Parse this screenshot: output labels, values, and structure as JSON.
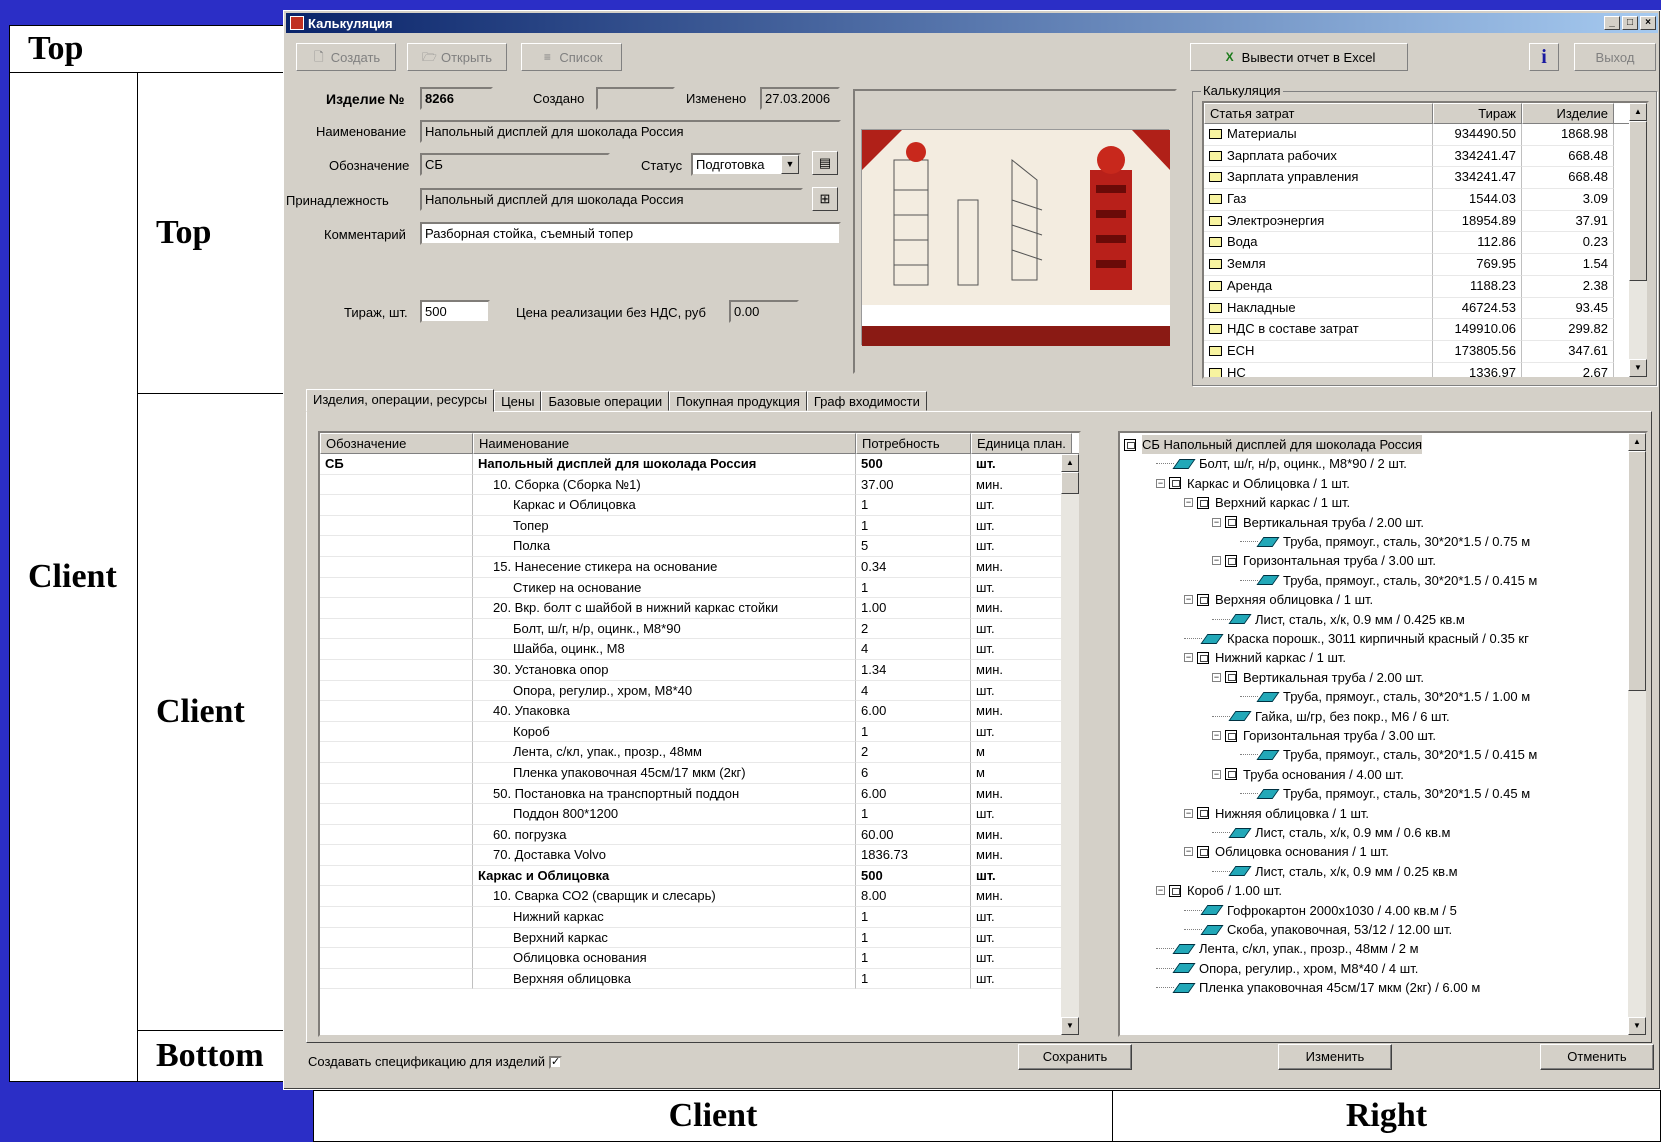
{
  "labels": {
    "top1": "Top",
    "client1": "Client",
    "top2": "Top",
    "client2": "Client",
    "bottom": "Bottom",
    "client3": "Client",
    "right": "Right"
  },
  "window": {
    "title": "Калькуляция"
  },
  "toolbar": {
    "create": "Создать",
    "open": "Открыть",
    "list": "Список",
    "excel": "Вывести отчет в Excel",
    "exit": "Выход",
    "info_icon": "info-icon"
  },
  "form": {
    "item_no_label": "Изделие №",
    "item_no": "8266",
    "created_label": "Создано",
    "created": "",
    "changed_label": "Изменено",
    "changed": "27.03.2006",
    "name_label": "Наименование",
    "name": "Напольный дисплей для шоколада Россия",
    "designation_label": "Обозначение",
    "designation": "СБ",
    "status_label": "Статус",
    "status": "Подготовка",
    "belongs_label": "Принадлежность",
    "belongs": "Напольный дисплей для шоколада Россия",
    "comment_label": "Комментарий",
    "comment": "Разборная стойка, съемный топер",
    "run_label": "Тираж, шт.",
    "run": "500",
    "price_label": "Цена реализации без НДС, руб",
    "price": "0.00"
  },
  "calc": {
    "title": "Калькуляция",
    "headers": [
      "Статья затрат",
      "Тираж",
      "Изделие"
    ],
    "rows": [
      [
        "Материалы",
        "934490.50",
        "1868.98"
      ],
      [
        "Зарплата рабочих",
        "334241.47",
        "668.48"
      ],
      [
        "Зарплата управления",
        "334241.47",
        "668.48"
      ],
      [
        "Газ",
        "1544.03",
        "3.09"
      ],
      [
        "Электроэнергия",
        "18954.89",
        "37.91"
      ],
      [
        "Вода",
        "112.86",
        "0.23"
      ],
      [
        "Земля",
        "769.95",
        "1.54"
      ],
      [
        "Аренда",
        "1188.23",
        "2.38"
      ],
      [
        "Накладные",
        "46724.53",
        "93.45"
      ],
      [
        "НДС в составе затрат",
        "149910.06",
        "299.82"
      ],
      [
        "ЕСН",
        "173805.56",
        "347.61"
      ],
      [
        "НС",
        "1336.97",
        "2.67"
      ]
    ]
  },
  "tabs": [
    "Изделия, операции, ресурсы",
    "Цены",
    "Базовые операции",
    "Покупная продукция",
    "Граф входимости"
  ],
  "ops": {
    "headers": [
      "Обозначение",
      "Наименование",
      "Потребность",
      "Единица план."
    ],
    "rows": [
      {
        "d": "СБ",
        "n": "Напольный дисплей для шоколада Россия",
        "q": "500",
        "u": "шт.",
        "lvl": 0,
        "b": true
      },
      {
        "d": "",
        "n": "10. Сборка (Сборка №1)",
        "q": "37.00",
        "u": "мин.",
        "lvl": 1
      },
      {
        "d": "",
        "n": "Каркас и Облицовка",
        "q": "1",
        "u": "шт.",
        "lvl": 2
      },
      {
        "d": "",
        "n": "Топер",
        "q": "1",
        "u": "шт.",
        "lvl": 2
      },
      {
        "d": "",
        "n": "Полка",
        "q": "5",
        "u": "шт.",
        "lvl": 2
      },
      {
        "d": "",
        "n": "15. Нанесение стикера на основание",
        "q": "0.34",
        "u": "мин.",
        "lvl": 1
      },
      {
        "d": "",
        "n": "Стикер на основание",
        "q": "1",
        "u": "шт.",
        "lvl": 2
      },
      {
        "d": "",
        "n": "20. Вкр. болт с шайбой в нижний каркас стойки",
        "q": "1.00",
        "u": "мин.",
        "lvl": 1
      },
      {
        "d": "",
        "n": "Болт, ш/г, н/р, оцинк., М8*90",
        "q": "2",
        "u": "шт.",
        "lvl": 2
      },
      {
        "d": "",
        "n": "Шайба, оцинк., М8",
        "q": "4",
        "u": "шт.",
        "lvl": 2
      },
      {
        "d": "",
        "n": "30. Установка опор",
        "q": "1.34",
        "u": "мин.",
        "lvl": 1
      },
      {
        "d": "",
        "n": "Опора, регулир., хром, М8*40",
        "q": "4",
        "u": "шт.",
        "lvl": 2
      },
      {
        "d": "",
        "n": "40. Упаковка",
        "q": "6.00",
        "u": "мин.",
        "lvl": 1
      },
      {
        "d": "",
        "n": "Короб",
        "q": "1",
        "u": "шт.",
        "lvl": 2
      },
      {
        "d": "",
        "n": "Лента, с/кл, упак., прозр., 48мм",
        "q": "2",
        "u": "м",
        "lvl": 2
      },
      {
        "d": "",
        "n": "Пленка упаковочная 45см/17 мкм (2кг)",
        "q": "6",
        "u": "м",
        "lvl": 2
      },
      {
        "d": "",
        "n": "50. Постановка на транспортный поддон",
        "q": "6.00",
        "u": "мин.",
        "lvl": 1
      },
      {
        "d": "",
        "n": "Поддон 800*1200",
        "q": "1",
        "u": "шт.",
        "lvl": 2
      },
      {
        "d": "",
        "n": "60. погрузка",
        "q": "60.00",
        "u": "мин.",
        "lvl": 1
      },
      {
        "d": "",
        "n": "70. Доставка Volvo",
        "q": "1836.73",
        "u": "мин.",
        "lvl": 1
      },
      {
        "d": "",
        "n": "Каркас и Облицовка",
        "q": "500",
        "u": "шт.",
        "lvl": 0,
        "b": true
      },
      {
        "d": "",
        "n": "10. Сварка СО2 (сварщик и слесарь)",
        "q": "8.00",
        "u": "мин.",
        "lvl": 1
      },
      {
        "d": "",
        "n": "Нижний каркас",
        "q": "1",
        "u": "шт.",
        "lvl": 2
      },
      {
        "d": "",
        "n": "Верхний каркас",
        "q": "1",
        "u": "шт.",
        "lvl": 2
      },
      {
        "d": "",
        "n": "Облицовка основания",
        "q": "1",
        "u": "шт.",
        "lvl": 2
      },
      {
        "d": "",
        "n": "Верхняя облицовка",
        "q": "1",
        "u": "шт.",
        "lvl": 2
      }
    ]
  },
  "tree": [
    {
      "t": "СБ Напольный дисплей для шоколада Россия",
      "lvl": 0,
      "k": "asm",
      "root": true
    },
    {
      "t": "Болт, ш/г, н/р, оцинк., М8*90 / 2 шт.",
      "lvl": 1,
      "k": "part"
    },
    {
      "t": "Каркас и Облицовка / 1 шт.",
      "lvl": 1,
      "k": "asm"
    },
    {
      "t": "Верхний каркас / 1 шт.",
      "lvl": 2,
      "k": "asm"
    },
    {
      "t": "Вертикальная труба / 2.00 шт.",
      "lvl": 3,
      "k": "asm"
    },
    {
      "t": "Труба, прямоуг., сталь, 30*20*1.5 / 0.75 м",
      "lvl": 4,
      "k": "part"
    },
    {
      "t": "Горизонтальная труба / 3.00 шт.",
      "lvl": 3,
      "k": "asm"
    },
    {
      "t": "Труба, прямоуг., сталь, 30*20*1.5 / 0.415 м",
      "lvl": 4,
      "k": "part"
    },
    {
      "t": "Верхняя облицовка / 1 шт.",
      "lvl": 2,
      "k": "asm"
    },
    {
      "t": "Лист, сталь, х/к, 0.9 мм / 0.425 кв.м",
      "lvl": 3,
      "k": "part"
    },
    {
      "t": "Краска порошк., 3011 кирпичный красный / 0.35 кг",
      "lvl": 2,
      "k": "part"
    },
    {
      "t": "Нижний каркас / 1 шт.",
      "lvl": 2,
      "k": "asm"
    },
    {
      "t": "Вертикальная труба / 2.00 шт.",
      "lvl": 3,
      "k": "asm"
    },
    {
      "t": "Труба, прямоуг., сталь, 30*20*1.5 / 1.00 м",
      "lvl": 4,
      "k": "part"
    },
    {
      "t": "Гайка, ш/гр, без покр., М6 / 6 шт.",
      "lvl": 3,
      "k": "part"
    },
    {
      "t": "Горизонтальная труба / 3.00 шт.",
      "lvl": 3,
      "k": "asm"
    },
    {
      "t": "Труба, прямоуг., сталь, 30*20*1.5 / 0.415 м",
      "lvl": 4,
      "k": "part"
    },
    {
      "t": "Труба основания / 4.00 шт.",
      "lvl": 3,
      "k": "asm"
    },
    {
      "t": "Труба, прямоуг., сталь, 30*20*1.5 / 0.45 м",
      "lvl": 4,
      "k": "part"
    },
    {
      "t": "Нижняя облицовка / 1 шт.",
      "lvl": 2,
      "k": "asm"
    },
    {
      "t": "Лист, сталь, х/к, 0.9 мм / 0.6 кв.м",
      "lvl": 3,
      "k": "part"
    },
    {
      "t": "Облицовка основания / 1 шт.",
      "lvl": 2,
      "k": "asm"
    },
    {
      "t": "Лист, сталь, х/к, 0.9 мм / 0.25 кв.м",
      "lvl": 3,
      "k": "part"
    },
    {
      "t": "Короб / 1.00 шт.",
      "lvl": 1,
      "k": "asm"
    },
    {
      "t": "Гофрокартон 2000х1030 / 4.00 кв.м / 5",
      "lvl": 2,
      "k": "part"
    },
    {
      "t": "Скоба, упаковочная, 53/12 / 12.00 шт.",
      "lvl": 2,
      "k": "part"
    },
    {
      "t": "Лента, с/кл, упак., прозр., 48мм / 2 м",
      "lvl": 1,
      "k": "part"
    },
    {
      "t": "Опора, регулир., хром, М8*40 / 4 шт.",
      "lvl": 1,
      "k": "part"
    },
    {
      "t": "Пленка упаковочная 45см/17 мкм (2кг) / 6.00 м",
      "lvl": 1,
      "k": "part"
    }
  ],
  "bottom": {
    "spec_label": "Создавать спецификацию для  изделий",
    "spec_checked": "✓",
    "save": "Сохранить",
    "edit": "Изменить",
    "cancel": "Отменить"
  }
}
